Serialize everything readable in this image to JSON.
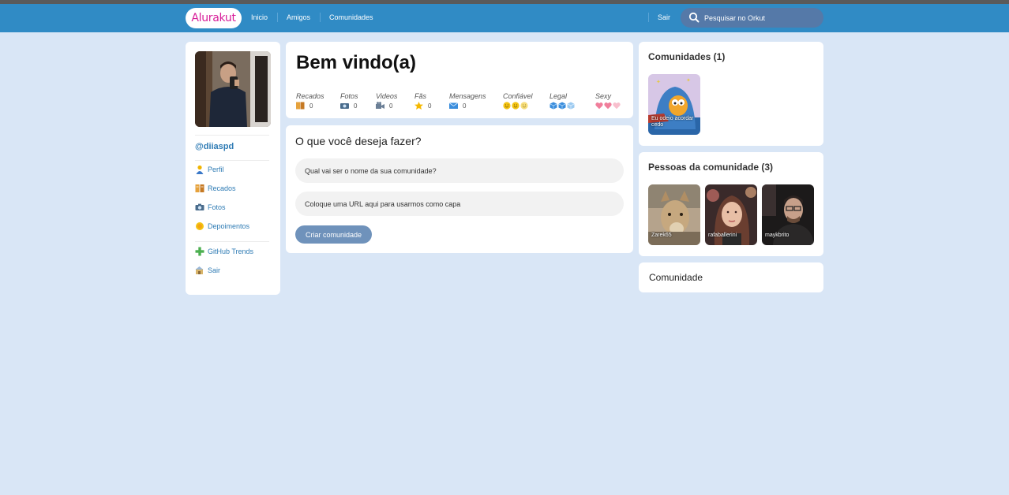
{
  "header": {
    "logo": "Alurakut",
    "nav": [
      "Inicio",
      "Amigos",
      "Comunidades"
    ],
    "logout": "Sair",
    "search_placeholder": "Pesquisar no Orkut",
    "accent": "#308bc5"
  },
  "sidebar": {
    "username": "@diiaspd",
    "items": [
      {
        "label": "Perfil",
        "icon": "user-icon"
      },
      {
        "label": "Recados",
        "icon": "book-icon"
      },
      {
        "label": "Fotos",
        "icon": "camera-icon"
      },
      {
        "label": "Depoimentos",
        "icon": "sun-icon"
      },
      {
        "label": "GitHub Trends",
        "icon": "plus-icon"
      },
      {
        "label": "Sair",
        "icon": "logout-icon"
      }
    ]
  },
  "welcome": {
    "title": "Bem vindo(a)",
    "stats": [
      {
        "label": "Recados",
        "value": "0",
        "icon": "book-icon"
      },
      {
        "label": "Fotos",
        "value": "0",
        "icon": "camera-icon"
      },
      {
        "label": "Videos",
        "value": "0",
        "icon": "video-icon"
      },
      {
        "label": "Fãs",
        "value": "0",
        "icon": "star-icon"
      },
      {
        "label": "Mensagens",
        "value": "0",
        "icon": "mail-icon"
      }
    ],
    "ratings": [
      {
        "label": "Confiável",
        "icon": "smiley-icon",
        "count": 3
      },
      {
        "label": "Legal",
        "icon": "cube-icon",
        "count": 3
      },
      {
        "label": "Sexy",
        "icon": "heart-icon",
        "count": 3
      }
    ]
  },
  "create": {
    "title": "O que você deseja fazer?",
    "name_placeholder": "Qual vai ser o nome da sua comunidade?",
    "url_placeholder": "Coloque uma URL aqui para usarmos como capa",
    "button": "Criar comunidade"
  },
  "communities": {
    "title": "Comunidades (1)",
    "items": [
      {
        "name": "Eu odeio acordar cedo"
      }
    ]
  },
  "people": {
    "title": "Pessoas da comunidade (3)",
    "items": [
      {
        "name": "Zarek65"
      },
      {
        "name": "rafaballerini"
      },
      {
        "name": "maykbrito"
      }
    ]
  },
  "community_box": {
    "title": "Comunidade"
  }
}
